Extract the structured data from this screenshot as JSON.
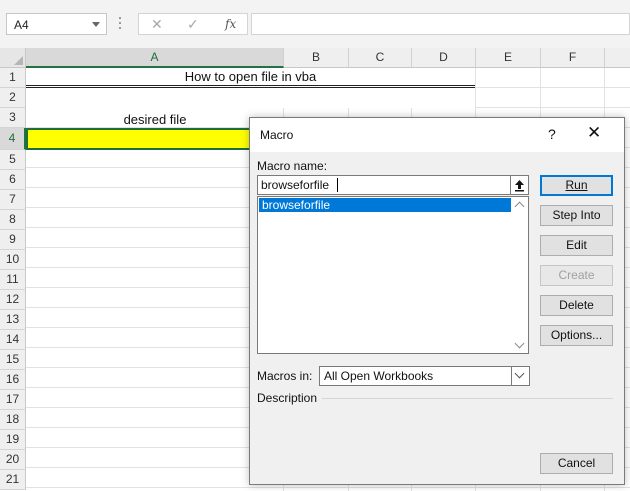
{
  "formula_bar": {
    "name_box": "A4",
    "cancel_symbol": "✕",
    "enter_symbol": "✓",
    "fx_symbol": "fx",
    "formula": ""
  },
  "sheet": {
    "columns": [
      "A",
      "B",
      "C",
      "D",
      "E",
      "F"
    ],
    "rows": [
      "1",
      "2",
      "3",
      "4",
      "5",
      "6",
      "7",
      "8",
      "9",
      "10",
      "11",
      "12",
      "13",
      "14",
      "15",
      "16",
      "17",
      "18",
      "19",
      "20",
      "21"
    ],
    "selected_column": "A",
    "selected_row": "4",
    "cells": {
      "A1": "How to open file in vba",
      "A3": "desired file",
      "A4_fill": "#ffff00"
    }
  },
  "dialog": {
    "title": "Macro",
    "help_symbol": "?",
    "close_symbol": "✕",
    "macro_name_label": "Macro name:",
    "macro_name_value": "browseforfile",
    "macros": [
      "browseforfile"
    ],
    "macros_in_label": "Macros in:",
    "macros_in_value": "All Open Workbooks",
    "description_label": "Description",
    "buttons": {
      "run": "Run",
      "step_into": "Step Into",
      "edit": "Edit",
      "create": "Create",
      "delete": "Delete",
      "options": "Options...",
      "cancel": "Cancel"
    }
  },
  "colors": {
    "selection_accent": "#217346",
    "highlight_fill": "#ffff00",
    "list_selection": "#0078d7"
  }
}
